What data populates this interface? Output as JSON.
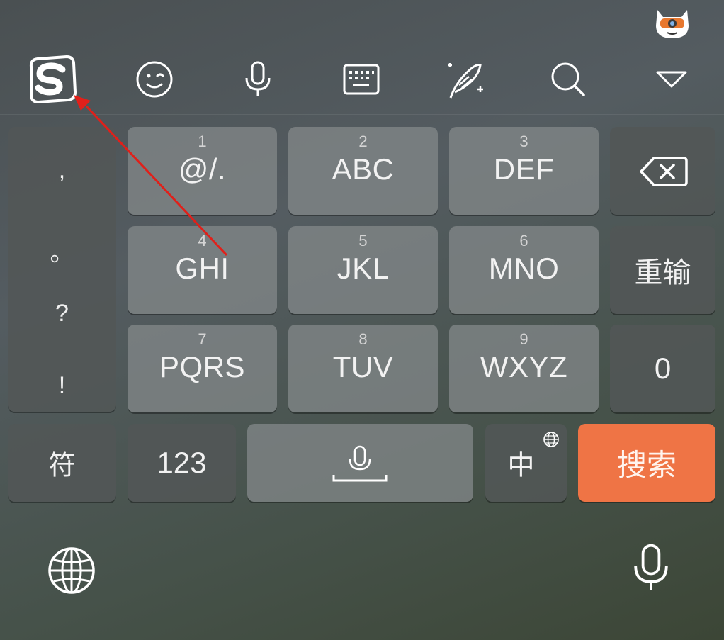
{
  "toolbar": {
    "icons": [
      "sogou-logo-icon",
      "emoji-icon",
      "microphone-icon",
      "keyboard-icon",
      "handwriting-icon",
      "search-icon",
      "collapse-triangle-icon"
    ]
  },
  "punctuation": [
    ",",
    "。",
    "?",
    "!"
  ],
  "keys": {
    "k1": {
      "num": "1",
      "label": "@/."
    },
    "k2": {
      "num": "2",
      "label": "ABC"
    },
    "k3": {
      "num": "3",
      "label": "DEF"
    },
    "k4": {
      "num": "4",
      "label": "GHI"
    },
    "k5": {
      "num": "5",
      "label": "JKL"
    },
    "k6": {
      "num": "6",
      "label": "MNO"
    },
    "k7": {
      "num": "7",
      "label": "PQRS"
    },
    "k8": {
      "num": "8",
      "label": "TUV"
    },
    "k9": {
      "num": "9",
      "label": "WXYZ"
    }
  },
  "side_keys": {
    "reinput": "重输",
    "zero": "0"
  },
  "bottom_row": {
    "symbols": "符",
    "numbers": "123",
    "chinese": "中",
    "search": "搜索"
  },
  "colors": {
    "accent": "#ef7445",
    "annotation_arrow": "#e0201a"
  }
}
